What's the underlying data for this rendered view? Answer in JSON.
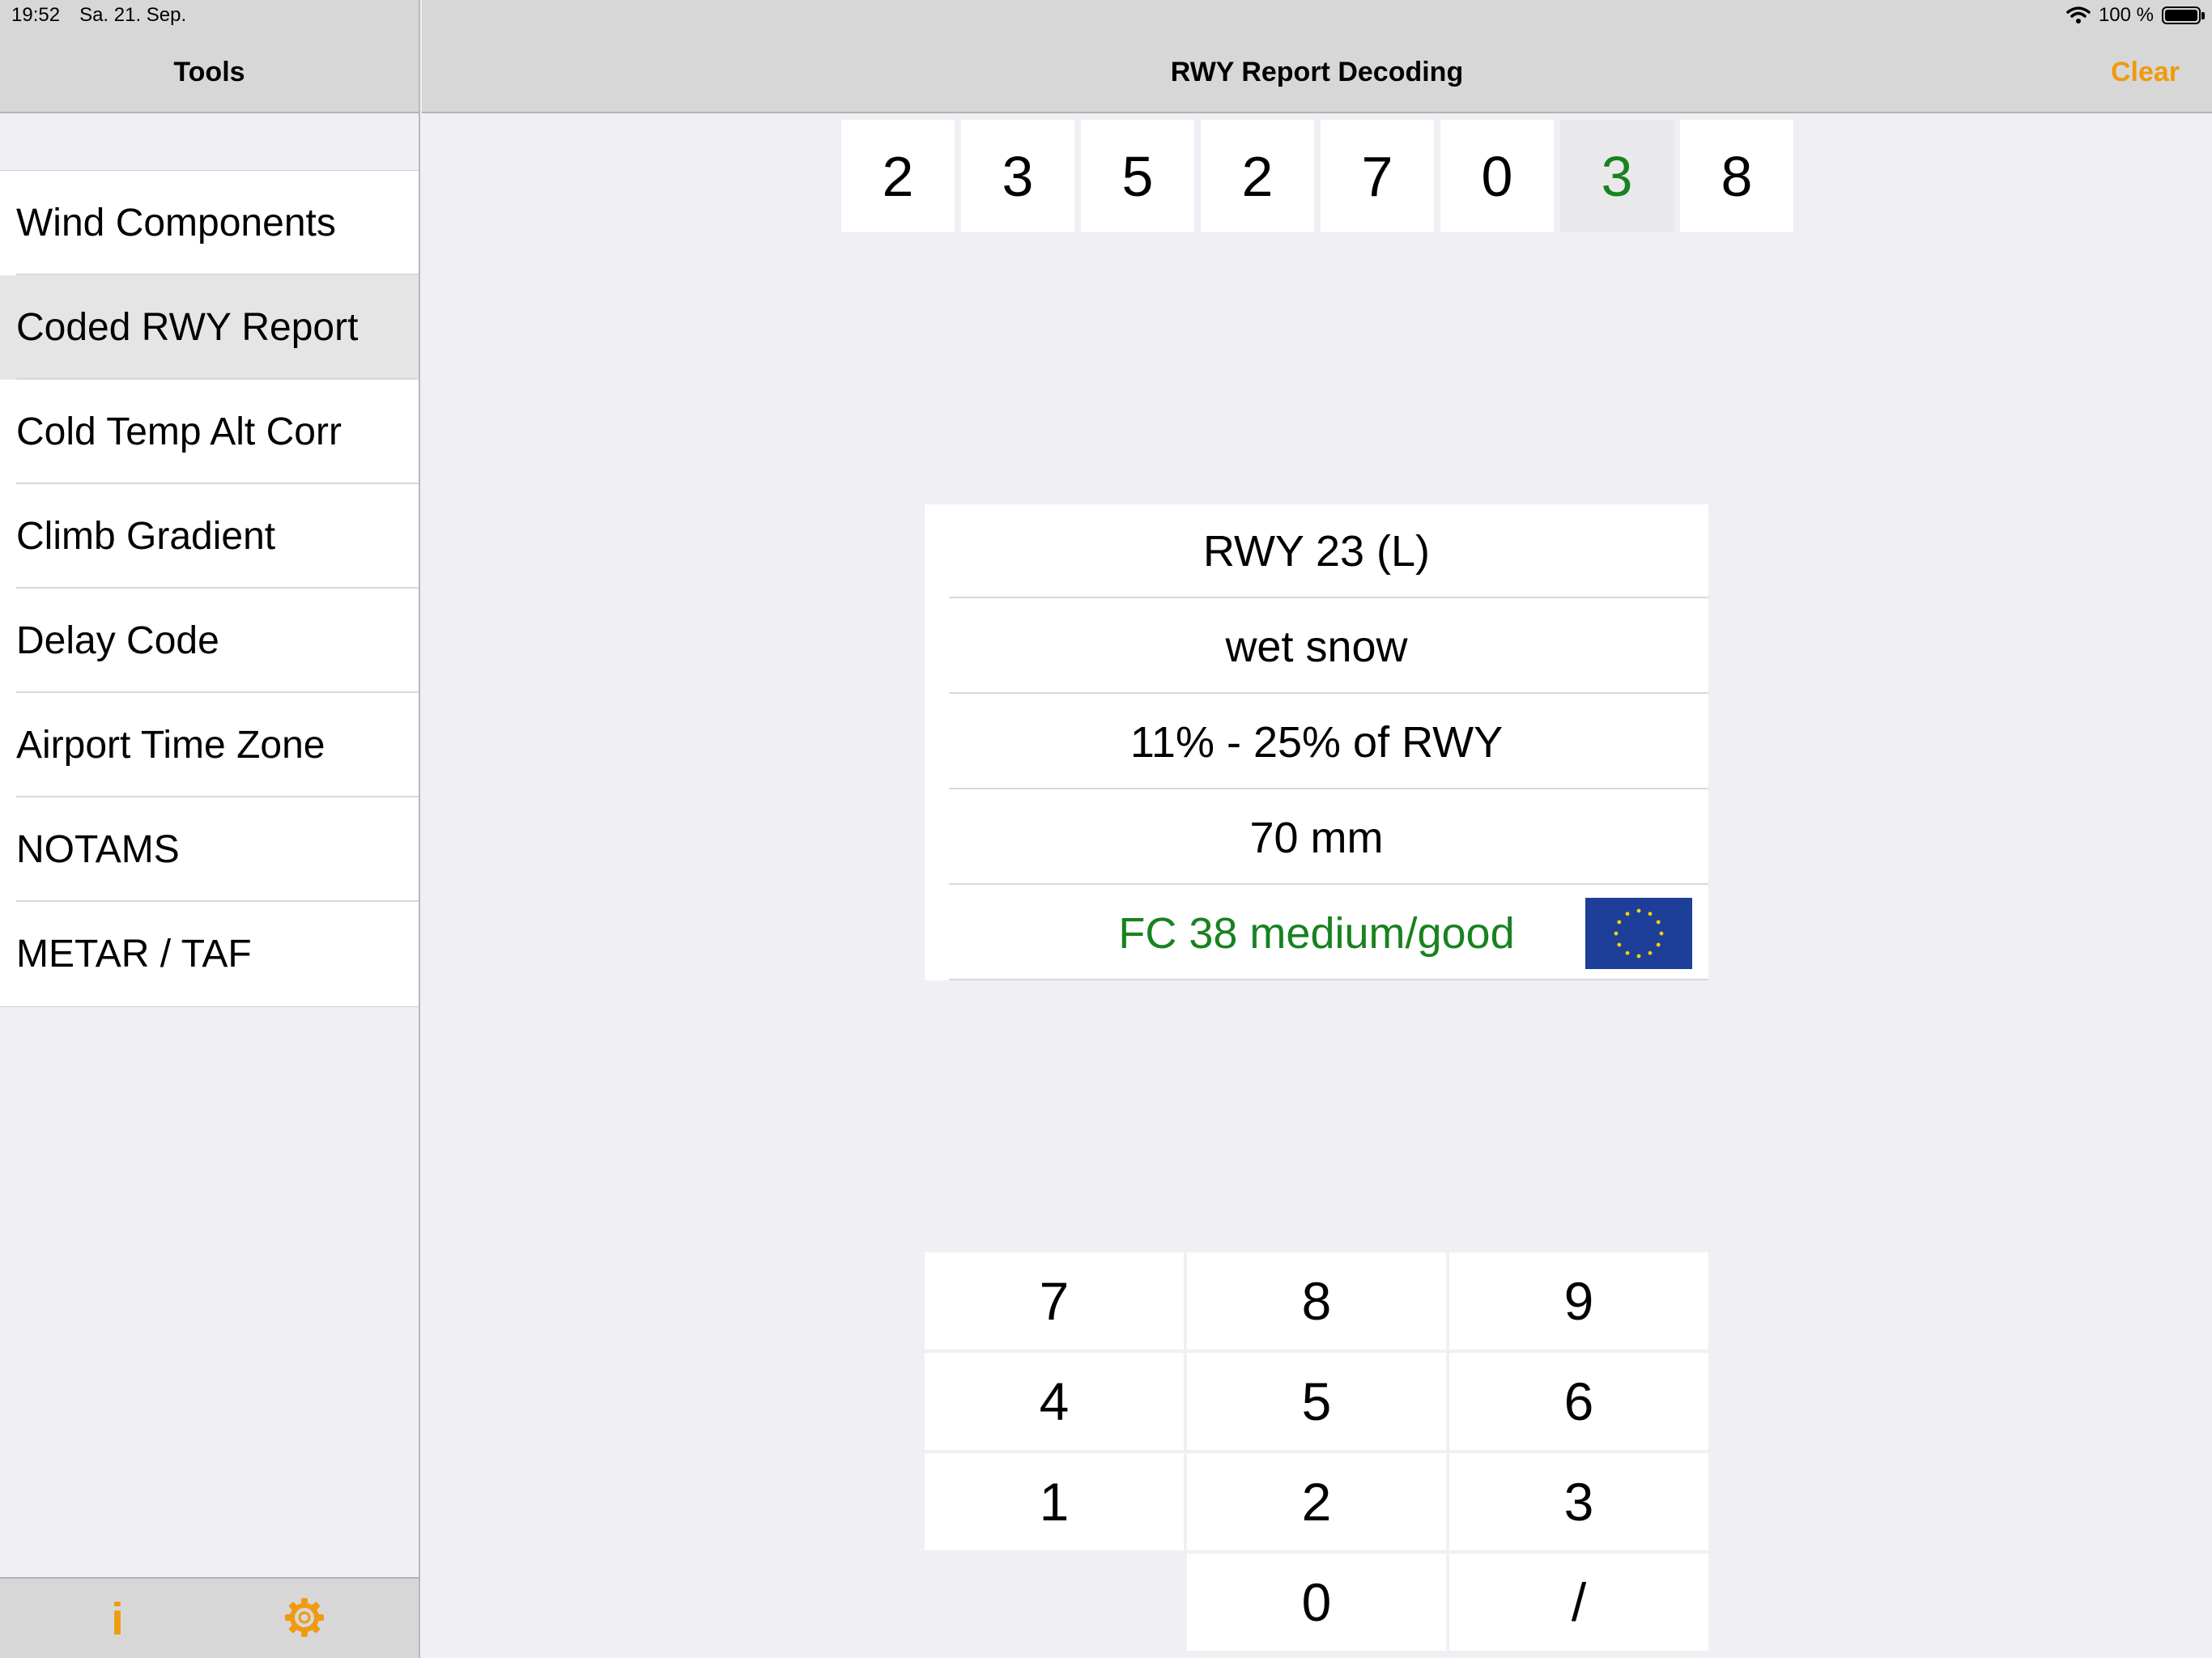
{
  "status_bar": {
    "time": "19:52",
    "date": "Sa. 21. Sep.",
    "battery_text": "100 %",
    "battery_level": 1.0
  },
  "sidebar": {
    "title": "Tools",
    "items": [
      {
        "label": "Wind Components",
        "selected": false
      },
      {
        "label": "Coded RWY Report",
        "selected": true
      },
      {
        "label": "Cold Temp Alt Corr",
        "selected": false
      },
      {
        "label": "Climb Gradient",
        "selected": false
      },
      {
        "label": "Delay Code",
        "selected": false
      },
      {
        "label": "Airport Time Zone",
        "selected": false
      },
      {
        "label": "NOTAMS",
        "selected": false
      },
      {
        "label": "METAR / TAF",
        "selected": false
      }
    ],
    "footer": {
      "info_icon": "info-icon",
      "settings_icon": "gear-icon"
    }
  },
  "main": {
    "title": "RWY Report Decoding",
    "clear_label": "Clear",
    "code_digits": [
      "2",
      "3",
      "5",
      "2",
      "7",
      "0",
      "3",
      "8"
    ],
    "active_digit_index": 6,
    "results": {
      "runway": "RWY 23 (L)",
      "deposit": "wet snow",
      "contamination": "11% - 25% of RWY",
      "depth": "70 mm",
      "friction": "FC 38 medium/good"
    },
    "keypad": [
      "7",
      "8",
      "9",
      "4",
      "5",
      "6",
      "1",
      "2",
      "3",
      "0",
      "/"
    ]
  },
  "colors": {
    "accent": "#f09a0e",
    "active_digit": "#18821f",
    "friction_text": "#18821f",
    "flag_blue": "#1d3f9a",
    "flag_star": "#f5d300"
  }
}
